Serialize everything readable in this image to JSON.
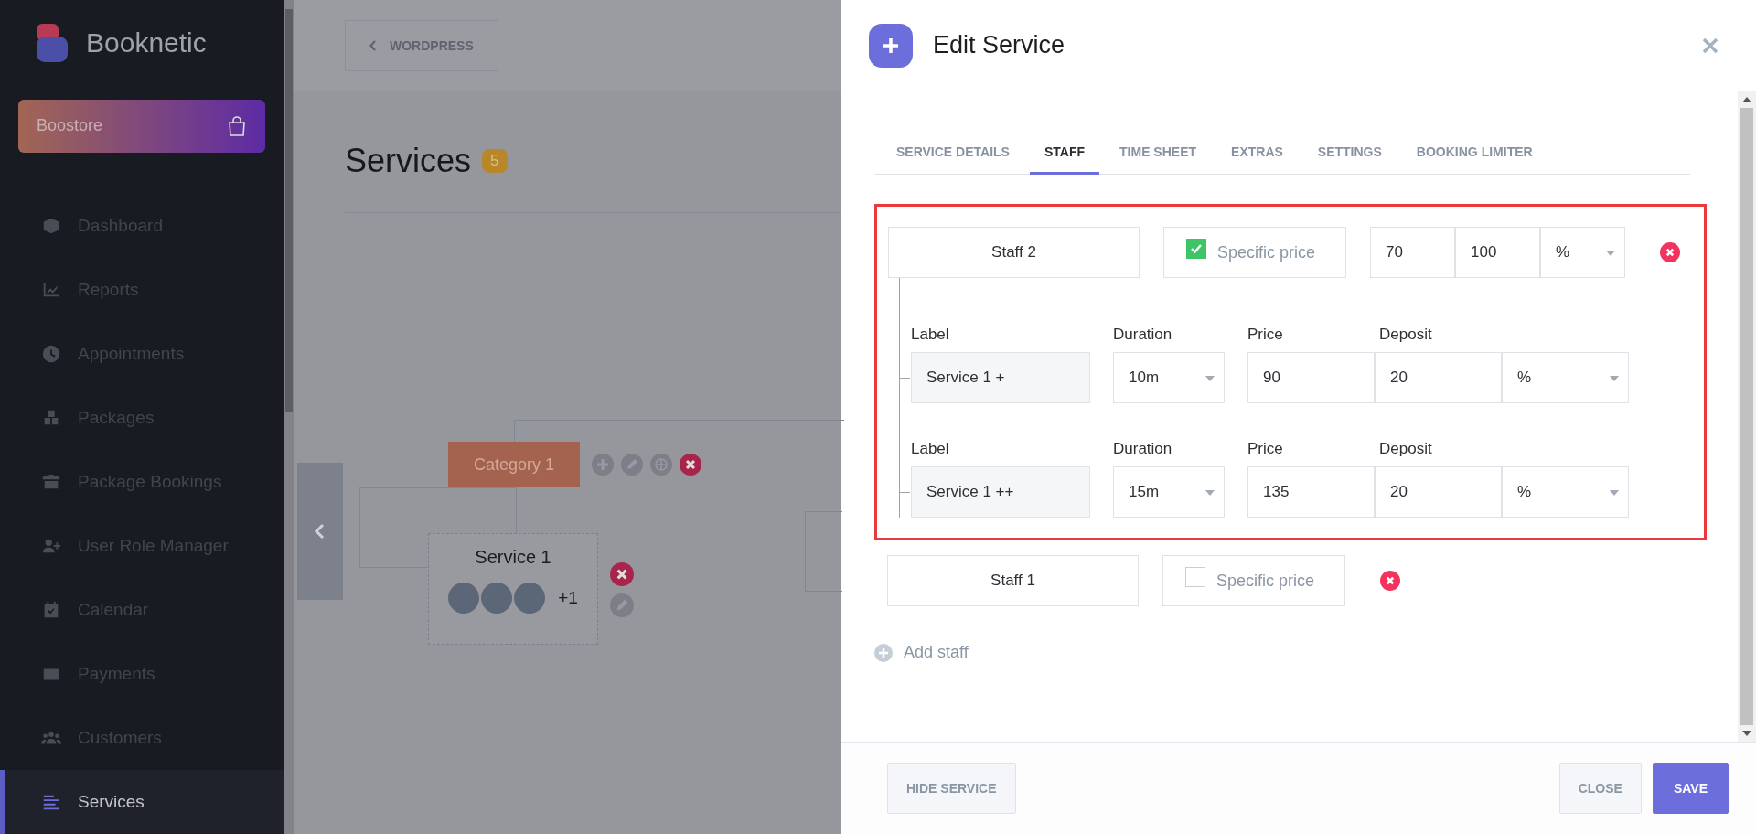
{
  "sidebar": {
    "brand": "Booknetic",
    "store": "Boostore",
    "items": [
      {
        "label": "Dashboard",
        "selected": false
      },
      {
        "label": "Reports",
        "selected": false
      },
      {
        "label": "Appointments",
        "selected": false
      },
      {
        "label": "Packages",
        "selected": false
      },
      {
        "label": "Package Bookings",
        "selected": false
      },
      {
        "label": "User Role Manager",
        "selected": false
      },
      {
        "label": "Calendar",
        "selected": false
      },
      {
        "label": "Payments",
        "selected": false
      },
      {
        "label": "Customers",
        "selected": false
      },
      {
        "label": "Services",
        "selected": true
      }
    ]
  },
  "main": {
    "back_button": "WORDPRESS",
    "title": "Services",
    "count": "5",
    "category": "Category 1",
    "service": {
      "name": "Service 1",
      "more_staff": "+1"
    }
  },
  "modal": {
    "title": "Edit Service",
    "tabs": [
      {
        "label": "SERVICE DETAILS",
        "selected": false
      },
      {
        "label": "STAFF",
        "selected": true
      },
      {
        "label": "TIME SHEET",
        "selected": false
      },
      {
        "label": "EXTRAS",
        "selected": false
      },
      {
        "label": "SETTINGS",
        "selected": false
      },
      {
        "label": "BOOKING LIMITER",
        "selected": false
      }
    ],
    "staff": [
      {
        "name": "Staff 2",
        "specific_price_label": "Specific price",
        "specific_price": true,
        "highlighted": true,
        "price": "70",
        "deposit": "100",
        "deposit_type": "%",
        "variants": [
          {
            "labels": [
              "Label",
              "Duration",
              "Price",
              "Deposit"
            ],
            "label": "Service 1 +",
            "duration": "10m",
            "price": "90",
            "deposit": "20",
            "deposit_type": "%"
          },
          {
            "labels": [
              "Label",
              "Duration",
              "Price",
              "Deposit"
            ],
            "label": "Service 1 ++",
            "duration": "15m",
            "price": "135",
            "deposit": "20",
            "deposit_type": "%"
          }
        ]
      },
      {
        "name": "Staff 1",
        "specific_price_label": "Specific price",
        "specific_price": false,
        "highlighted": false
      }
    ],
    "add_staff": "Add staff",
    "footer": {
      "hide": "HIDE SERVICE",
      "close": "CLOSE",
      "save": "SAVE"
    }
  }
}
